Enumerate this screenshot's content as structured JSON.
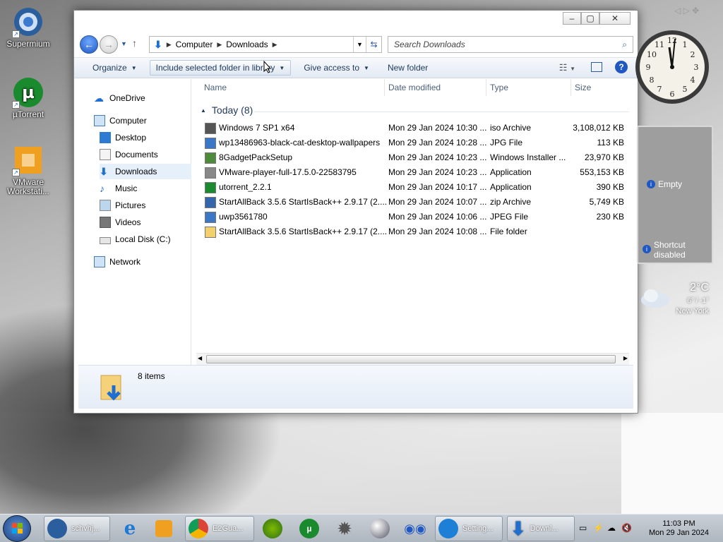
{
  "desktop": {
    "icons": [
      {
        "label": "Supermium"
      },
      {
        "label": "µTorrent"
      },
      {
        "label": "VMware Workstati..."
      }
    ]
  },
  "window": {
    "address": {
      "segments": [
        "Computer",
        "Downloads"
      ]
    },
    "search_placeholder": "Search Downloads",
    "toolbar": {
      "organize": "Organize",
      "include": "Include selected folder in library",
      "give_access": "Give access to",
      "new_folder": "New folder"
    },
    "nav": {
      "onedrive": "OneDrive",
      "computer": "Computer",
      "desktop": "Desktop",
      "documents": "Documents",
      "downloads": "Downloads",
      "music": "Music",
      "pictures": "Pictures",
      "videos": "Videos",
      "local_disk": "Local Disk (C:)",
      "network": "Network"
    },
    "columns": {
      "name": "Name",
      "date": "Date modified",
      "type": "Type",
      "size": "Size"
    },
    "group_label": "Today (8)",
    "files": [
      {
        "name": "Windows 7 SP1 x64",
        "date": "Mon 29 Jan 2024 10:30 ...",
        "type": "iso Archive",
        "size": "3,108,012 KB"
      },
      {
        "name": "wp13486963-black-cat-desktop-wallpapers",
        "date": "Mon 29 Jan 2024 10:28 ...",
        "type": "JPG File",
        "size": "113 KB"
      },
      {
        "name": "8GadgetPackSetup",
        "date": "Mon 29 Jan 2024 10:23 ...",
        "type": "Windows Installer ...",
        "size": "23,970 KB"
      },
      {
        "name": "VMware-player-full-17.5.0-22583795",
        "date": "Mon 29 Jan 2024 10:23 ...",
        "type": "Application",
        "size": "553,153 KB"
      },
      {
        "name": "utorrent_2.2.1",
        "date": "Mon 29 Jan 2024 10:17 ...",
        "type": "Application",
        "size": "390 KB"
      },
      {
        "name": "StartAllBack 3.5.6 StartIsBack++ 2.9.17 (2....",
        "date": "Mon 29 Jan 2024 10:07 ...",
        "type": "zip Archive",
        "size": "5,749 KB"
      },
      {
        "name": "uwp3561780",
        "date": "Mon 29 Jan 2024 10:06 ...",
        "type": "JPEG File",
        "size": "230 KB"
      },
      {
        "name": "StartAllBack 3.5.6 StartIsBack++ 2.9.17 (2....",
        "date": "Mon 29 Jan 2024 10:08 ...",
        "type": "File folder",
        "size": ""
      }
    ],
    "status": "8 items"
  },
  "gadgets": {
    "slideshow_empty": "Empty",
    "shortcut_disabled": "Shortcut disabled",
    "weather_temp": "2°C",
    "weather_range": "6° / -1°",
    "weather_city": "New York"
  },
  "taskbar": {
    "tasks": [
      {
        "label": "schvhj..."
      },
      {
        "label": "E2Gua..."
      },
      {
        "label": "Setting..."
      },
      {
        "label": "Downl..."
      }
    ],
    "time": "11:03 PM",
    "date": "Mon 29 Jan 2024"
  },
  "colors": {
    "accent": "#1f58c2",
    "selection": "#e5f0fb"
  }
}
